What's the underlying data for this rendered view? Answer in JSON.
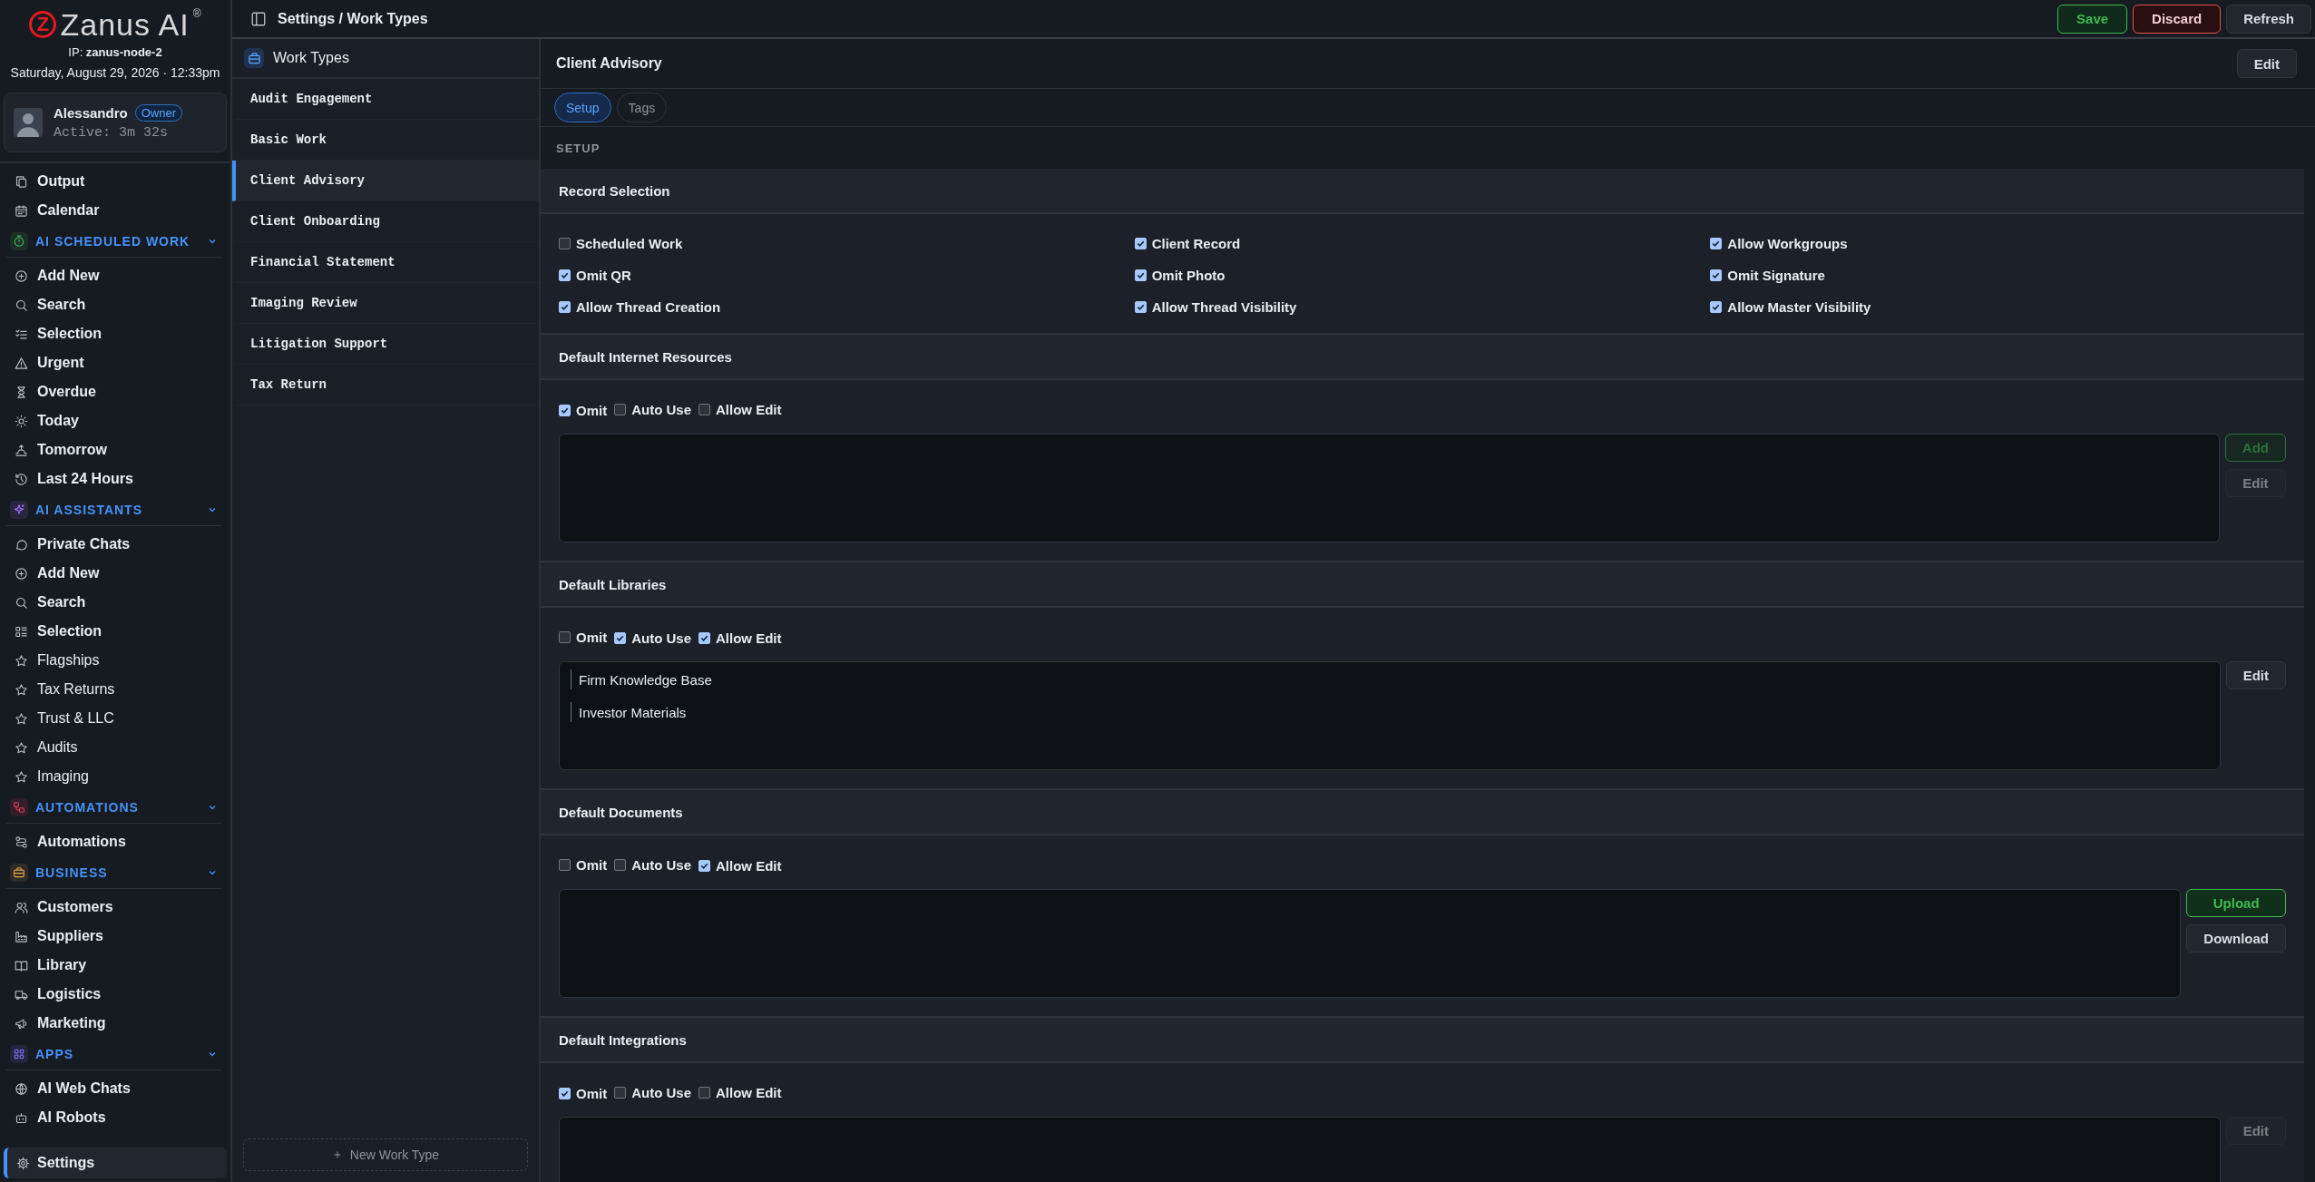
{
  "brand": {
    "mark": "Z",
    "name": "Zanus AI",
    "registered": "®",
    "ip": "IP: **zanus-node-2**",
    "datetime": "Saturday, August 29, 2026 · 12:33pm"
  },
  "user": {
    "name": "Alessandro",
    "role": "Owner",
    "active": "Active: 3m 32s"
  },
  "nav": [
    {
      "kind": "link",
      "label": "Output"
    },
    {
      "kind": "link",
      "label": "Calendar"
    },
    {
      "kind": "section",
      "label": "AI SCHEDULED WORK",
      "color": "#3fb950",
      "expanded": true
    },
    {
      "kind": "link",
      "label": "Add New"
    },
    {
      "kind": "link",
      "label": "Search"
    },
    {
      "kind": "link",
      "label": "Selection"
    },
    {
      "kind": "link",
      "label": "Urgent"
    },
    {
      "kind": "link",
      "label": "Overdue"
    },
    {
      "kind": "link",
      "label": "Today"
    },
    {
      "kind": "link",
      "label": "Tomorrow"
    },
    {
      "kind": "link",
      "label": "Last 24 Hours"
    },
    {
      "kind": "section",
      "label": "AI ASSISTANTS",
      "color": "#a371f7",
      "expanded": true
    },
    {
      "kind": "link",
      "label": "Private Chats"
    },
    {
      "kind": "link",
      "label": "Add New"
    },
    {
      "kind": "link",
      "label": "Search"
    },
    {
      "kind": "link",
      "label": "Selection"
    },
    {
      "kind": "favorite",
      "label": "Flagships"
    },
    {
      "kind": "favorite",
      "label": "Tax Returns"
    },
    {
      "kind": "favorite",
      "label": "Trust & LLC"
    },
    {
      "kind": "favorite",
      "label": "Audits"
    },
    {
      "kind": "favorite",
      "label": "Imaging"
    },
    {
      "kind": "section",
      "label": "AUTOMATIONS",
      "color": "#e5395a",
      "expanded": true
    },
    {
      "kind": "link",
      "label": "Automations"
    },
    {
      "kind": "section",
      "label": "BUSINESS",
      "color": "#e0a04a",
      "expanded": true
    },
    {
      "kind": "link",
      "label": "Customers"
    },
    {
      "kind": "link",
      "label": "Suppliers"
    },
    {
      "kind": "link",
      "label": "Library"
    },
    {
      "kind": "link",
      "label": "Logistics"
    },
    {
      "kind": "link",
      "label": "Marketing"
    },
    {
      "kind": "section",
      "label": "APPS",
      "color": "#7c6cf0",
      "expanded": true
    },
    {
      "kind": "link",
      "label": "AI Web Chats"
    },
    {
      "kind": "link",
      "label": "AI Robots"
    }
  ],
  "settings": {
    "label": "Settings",
    "selected": true
  },
  "topbar": {
    "breadcrumb": "Settings / Work Types",
    "buttons": [
      {
        "kind": "save",
        "label": "Save"
      },
      {
        "kind": "discard",
        "label": "Discard"
      },
      {
        "kind": "plain",
        "label": "Refresh"
      }
    ]
  },
  "work_types": {
    "title": "Work Types",
    "items": [
      {
        "label": "Audit Engagement",
        "selected": false
      },
      {
        "label": "Basic Work",
        "selected": false
      },
      {
        "label": "Client Advisory",
        "selected": true
      },
      {
        "label": "Client Onboarding",
        "selected": false
      },
      {
        "label": "Financial Statement",
        "selected": false
      },
      {
        "label": "Imaging Review",
        "selected": false
      },
      {
        "label": "Litigation Support",
        "selected": false
      },
      {
        "label": "Tax Return",
        "selected": false
      }
    ],
    "new_button": "New Work Type"
  },
  "detail": {
    "title": "Client Advisory",
    "edit_button": "Edit",
    "tabs": [
      {
        "label": "Setup",
        "selected": true
      },
      {
        "label": "Tags",
        "selected": false
      }
    ],
    "section_label": "SETUP",
    "panels": [
      {
        "kind": "grid",
        "title": "Record Selection",
        "options": [
          {
            "label": "Scheduled Work",
            "checked": false
          },
          {
            "label": "Client Record",
            "checked": true
          },
          {
            "label": "Allow Workgroups",
            "checked": true
          },
          {
            "label": "Omit QR",
            "checked": true
          },
          {
            "label": "Omit Photo",
            "checked": true
          },
          {
            "label": "Omit Signature",
            "checked": true
          },
          {
            "label": "Allow Thread Creation",
            "checked": true
          },
          {
            "label": "Allow Thread Visibility",
            "checked": true
          },
          {
            "label": "Allow Master Visibility",
            "checked": true
          }
        ]
      },
      {
        "kind": "box",
        "title": "Default Internet Resources",
        "options": [
          {
            "label": "Omit",
            "checked": true
          },
          {
            "label": "Auto Use",
            "checked": false
          },
          {
            "label": "Allow Edit",
            "checked": false
          }
        ],
        "buttons": [
          {
            "kind": "add",
            "label": "Add",
            "disabled": true
          },
          {
            "kind": "plain",
            "label": "Edit",
            "disabled": true
          }
        ]
      },
      {
        "kind": "box",
        "title": "Default Libraries",
        "options": [
          {
            "label": "Omit",
            "checked": false
          },
          {
            "label": "Auto Use",
            "checked": true
          },
          {
            "label": "Allow Edit",
            "checked": true
          }
        ],
        "entries": [
          "Firm Knowledge Base",
          "Investor Materials"
        ],
        "buttons": [
          {
            "kind": "plain",
            "label": "Edit",
            "disabled": false
          }
        ]
      },
      {
        "kind": "box",
        "title": "Default Documents",
        "options": [
          {
            "label": "Omit",
            "checked": false
          },
          {
            "label": "Auto Use",
            "checked": false
          },
          {
            "label": "Allow Edit",
            "checked": true
          }
        ],
        "buttons": [
          {
            "kind": "add",
            "label": "Upload",
            "disabled": false
          },
          {
            "kind": "plain",
            "label": "Download",
            "disabled": false
          }
        ]
      },
      {
        "kind": "box",
        "title": "Default Integrations",
        "options": [
          {
            "label": "Omit",
            "checked": true
          },
          {
            "label": "Auto Use",
            "checked": false
          },
          {
            "label": "Allow Edit",
            "checked": false
          }
        ],
        "buttons": [
          {
            "kind": "plain",
            "label": "Edit",
            "disabled": true
          }
        ]
      }
    ]
  }
}
